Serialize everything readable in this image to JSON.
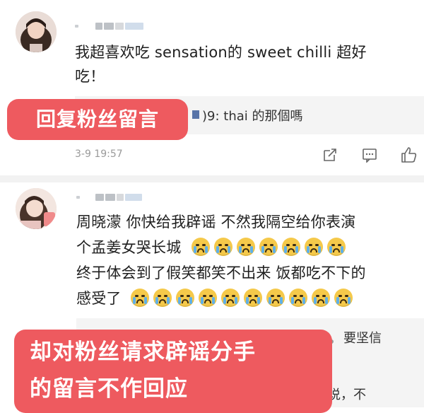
{
  "comment1": {
    "text_line1": "我超喜欢吃 sensation的 sweet chilli 超好",
    "text_line2": "吃！",
    "reply": ")9: thai 的那個嗎",
    "timestamp": "3-9 19:57",
    "overlay": "回复粉丝留言"
  },
  "comment2": {
    "line1": "周晓濛 你快给我辟谣 不然我隔空给你表演",
    "line2_text": "个孟姜女哭长城",
    "line3": "终于体会到了假笑都笑不出来 饭都吃不下的",
    "line4_text": "感受了",
    "reply_line1": "要坚信",
    "reply_line2": "几天好多营销号说，不",
    "overlay_line1": "却对粉丝请求辟谣分手",
    "overlay_line2": "的留言不作回应"
  },
  "icons": {
    "share": "share-icon",
    "comment": "comment-icon",
    "like": "like-icon",
    "emoji": "crying-emoji-icon"
  },
  "colors": {
    "overlay": "#ee5a5f",
    "reply_bg": "#f4f4f4"
  }
}
